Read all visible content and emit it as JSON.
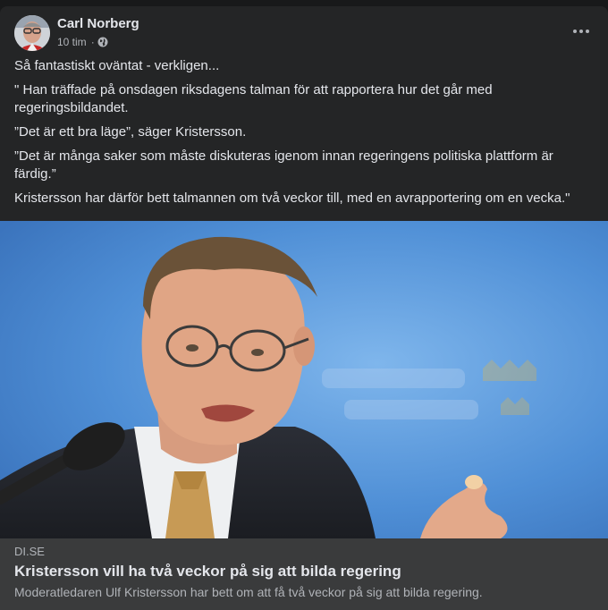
{
  "post": {
    "author": {
      "name": "Carl Norberg",
      "avatar_icon": "profile-photo"
    },
    "timestamp": "10 tim",
    "separator": "·",
    "audience_icon": "globe-icon",
    "more_icon": "more-options-icon",
    "text": [
      "Så fantastiskt oväntat - verkligen...",
      "\" Han träffade på onsdagen riksdagens talman för att rapportera hur det går med regeringsbildandet.",
      "”Det är ett bra läge”, säger Kristersson.",
      "”Det är många saker som måste diskuteras igenom innan regeringens politiska plattform är färdig.”",
      "Kristersson har därför bett talmannen om två veckor till, med en avrapportering om en vecka.\""
    ],
    "link": {
      "image_description_icon": "article-photo",
      "domain": "DI.SE",
      "title": "Kristersson vill ha två veckor på sig att bilda regering",
      "description": "Moderatledaren Ulf Kristersson har bett om att få två veckor på sig att bilda regering."
    }
  },
  "colors": {
    "page_bg": "#18191a",
    "card_bg": "#242526",
    "link_bg": "#3a3b3c",
    "primary_text": "#e4e6eb",
    "secondary_text": "#b0b3b8",
    "photo_backdrop": "#4f8fd6"
  }
}
